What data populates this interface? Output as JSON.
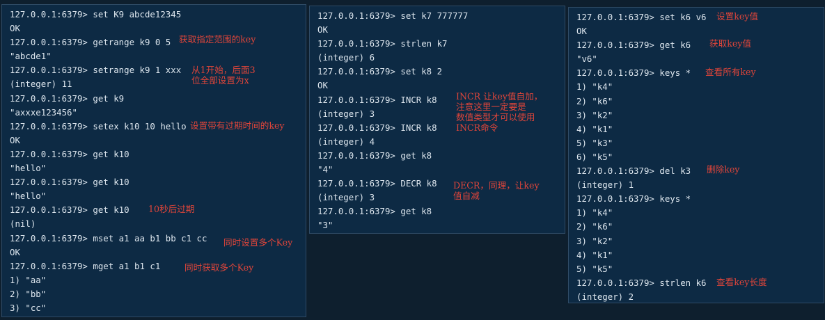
{
  "terminals": [
    {
      "lines": [
        "127.0.0.1:6379> set K9 abcde12345",
        "OK",
        "127.0.0.1:6379> getrange k9 0 5",
        "\"abcde1\"",
        "127.0.0.1:6379> setrange k9 1 xxx",
        "(integer) 11",
        "127.0.0.1:6379> get k9",
        "\"axxxe123456\"",
        "127.0.0.1:6379> setex k10 10 hello",
        "OK",
        "127.0.0.1:6379> get k10",
        "\"hello\"",
        "127.0.0.1:6379> get k10",
        "\"hello\"",
        "127.0.0.1:6379> get k10",
        "(nil)",
        "127.0.0.1:6379> mset a1 aa b1 bb c1 cc",
        "OK",
        "127.0.0.1:6379> mget a1 b1 c1",
        "1) \"aa\"",
        "2) \"bb\"",
        "3) \"cc\""
      ],
      "notes": [
        "获取指定范围的key",
        "从1开始，后面3\n位全部设置为x",
        "设置带有过期时间的key",
        "10秒后过期",
        "同时设置多个Key",
        "同时获取多个Key"
      ]
    },
    {
      "lines": [
        "127.0.0.1:6379> set k7 777777",
        "OK",
        "127.0.0.1:6379> strlen k7",
        "(integer) 6",
        "127.0.0.1:6379> set k8 2",
        "OK",
        "127.0.0.1:6379> INCR k8",
        "(integer) 3",
        "127.0.0.1:6379> INCR k8",
        "(integer) 4",
        "127.0.0.1:6379> get k8",
        "\"4\"",
        "127.0.0.1:6379> DECR k8",
        "(integer) 3",
        "127.0.0.1:6379> get k8",
        "\"3\""
      ],
      "notes": [
        "INCR 让key值自加，\n注意这里一定要是\n数值类型才可以使用\nINCR命令",
        "DECR，同理，让key\n值自减"
      ]
    },
    {
      "lines": [
        "127.0.0.1:6379> set k6 v6",
        "OK",
        "127.0.0.1:6379> get k6",
        "\"v6\"",
        "127.0.0.1:6379> keys *",
        "1) \"k4\"",
        "2) \"k6\"",
        "3) \"k2\"",
        "4) \"k1\"",
        "5) \"k3\"",
        "6) \"k5\"",
        "127.0.0.1:6379> del k3",
        "(integer) 1",
        "127.0.0.1:6379> keys *",
        "1) \"k4\"",
        "2) \"k6\"",
        "3) \"k2\"",
        "4) \"k1\"",
        "5) \"k5\"",
        "127.0.0.1:6379> strlen k6",
        "(integer) 2"
      ],
      "notes": [
        "设置key值",
        "获取key值",
        "查看所有key",
        "删除key",
        "查看key长度"
      ]
    }
  ]
}
